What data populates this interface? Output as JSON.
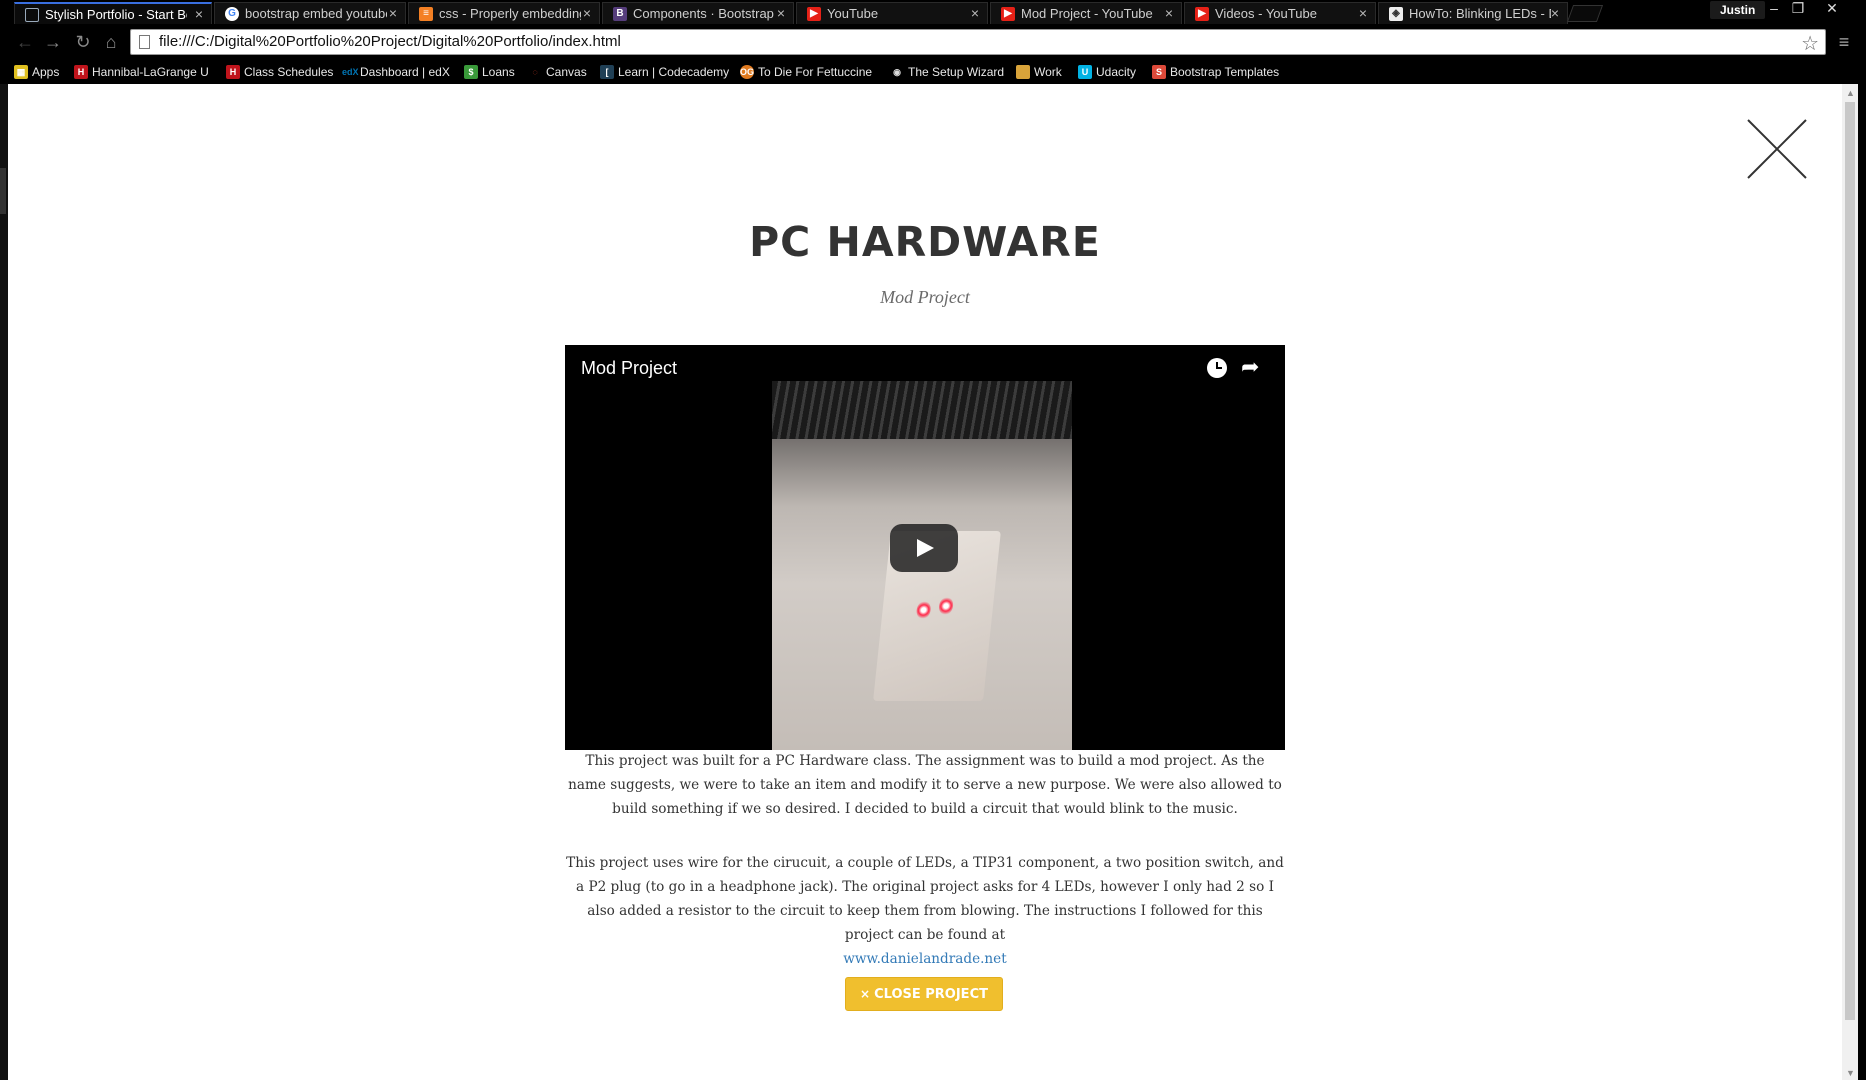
{
  "browser": {
    "tabs": [
      {
        "label": "Stylish Portfolio - Start Bo",
        "favicon": "page-icon",
        "color": "#2a5bd7",
        "active": true
      },
      {
        "label": "bootstrap embed youtube",
        "favicon": "google-icon",
        "color": "#4285f4",
        "active": false
      },
      {
        "label": "css - Properly embedding",
        "favicon": "stackoverflow-icon",
        "color": "#f48024",
        "active": false
      },
      {
        "label": "Components · Bootstrap",
        "favicon": "bootstrap-icon",
        "color": "#563d7c",
        "active": false
      },
      {
        "label": "YouTube",
        "favicon": "youtube-icon",
        "color": "#e62117",
        "active": false
      },
      {
        "label": "Mod Project - YouTube",
        "favicon": "youtube-icon",
        "color": "#e62117",
        "active": false
      },
      {
        "label": "Videos - YouTube",
        "favicon": "youtube-icon",
        "color": "#e62117",
        "active": false
      },
      {
        "label": "HowTo: Blinking LEDs - Da",
        "favicon": "site-icon",
        "color": "#777777",
        "active": false
      }
    ],
    "tab_close": "×",
    "profile": "Justin",
    "window_buttons": {
      "minimize": "–",
      "restore": "❐",
      "close": "✕"
    },
    "url": "file:///C:/Digital%20Portfolio%20Project/Digital%20Portfolio/index.html",
    "bookmarks": [
      {
        "label": "Apps",
        "icon": "apps-grid-icon",
        "color": "#e0c020"
      },
      {
        "label": "Hannibal-LaGrange U",
        "icon": "hlgu-icon",
        "color": "#c0141c"
      },
      {
        "label": "Class Schedules",
        "icon": "schedule-icon",
        "color": "#c0141c"
      },
      {
        "label": "Dashboard | edX",
        "icon": "edx-icon",
        "color": "#0075b4"
      },
      {
        "label": "Loans",
        "icon": "loans-icon",
        "color": "#3a9a3a"
      },
      {
        "label": "Canvas",
        "icon": "canvas-icon",
        "color": "#e13f29"
      },
      {
        "label": "Learn | Codecademy",
        "icon": "codecademy-icon",
        "color": "#204056"
      },
      {
        "label": "To Die For Fettuccine",
        "icon": "food-icon",
        "color": "#e07a1f"
      },
      {
        "label": "The Setup Wizard",
        "icon": "wifi-icon",
        "color": "#888888"
      },
      {
        "label": "Work",
        "icon": "folder-icon",
        "color": "#d9a43a"
      },
      {
        "label": "Udacity",
        "icon": "udacity-icon",
        "color": "#02b3e4"
      },
      {
        "label": "Bootstrap Templates",
        "icon": "startbootstrap-icon",
        "color": "#dd4a3a"
      }
    ]
  },
  "modal": {
    "title": "PC HARDWARE",
    "subtitle": "Mod Project",
    "video": {
      "title": "Mod Project",
      "watch_later_icon": "clock-icon",
      "share_icon": "share-icon",
      "share_glyph": "➦",
      "play_icon": "play-icon"
    },
    "paragraph1": "This project was built for a PC Hardware class. The assignment was to build a mod project. As the name suggests, we were to take an item and modify it to serve a new purpose. We were also allowed to build something if we so desired. I decided to build a circuit that would blink to the music.",
    "paragraph2": "This project uses wire for the cirucuit, a couple of LEDs, a TIP31 component, a two position switch, and a P2 plug (to go in a headphone jack). The original project asks for 4 LEDs, however I only had 2 so I also added a resistor to the circuit to keep them from blowing. The instructions I followed for this project can be found at",
    "link_text": "www.danielandrade.net",
    "close_button": {
      "icon": "×",
      "label": "CLOSE PROJECT",
      "color": "#f0bf2e"
    }
  }
}
